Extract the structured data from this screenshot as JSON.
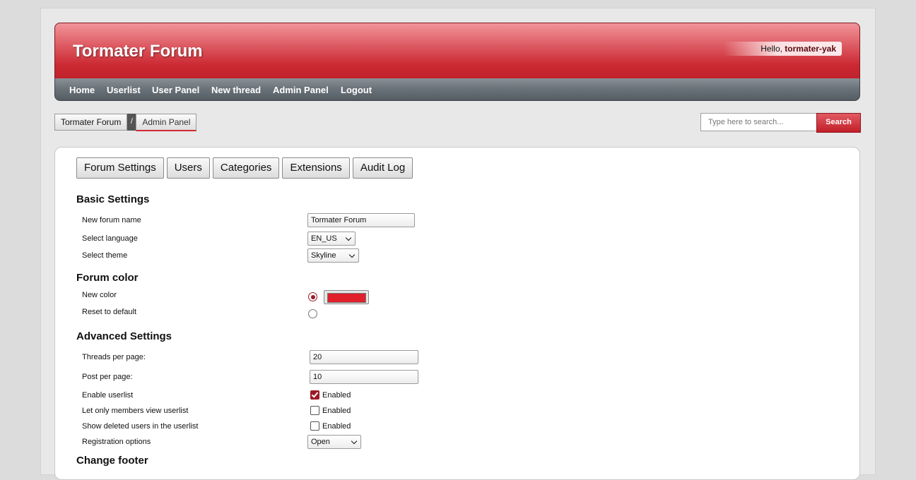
{
  "header": {
    "forum_title": "Tormater Forum",
    "hello_prefix": "Hello,",
    "username": "tormater-yak"
  },
  "nav": {
    "items": [
      "Home",
      "Userlist",
      "User Panel",
      "New thread",
      "Admin Panel",
      "Logout"
    ]
  },
  "breadcrumb": {
    "root": "Tormater Forum",
    "separator": "/",
    "current": "Admin Panel"
  },
  "search": {
    "placeholder": "Type here to search...",
    "button_label": "Search"
  },
  "tabs": [
    "Forum Settings",
    "Users",
    "Categories",
    "Extensions",
    "Audit Log"
  ],
  "basic_settings": {
    "title": "Basic Settings",
    "forum_name_label": "New forum name",
    "forum_name_value": "Tormater Forum",
    "language_label": "Select language",
    "language_value": "EN_US",
    "theme_label": "Select theme",
    "theme_value": "Skyline"
  },
  "forum_color": {
    "title": "Forum color",
    "new_color_label": "New color",
    "reset_label": "Reset to default",
    "color_value": "#e0202a",
    "selected_option": "New color"
  },
  "advanced_settings": {
    "title": "Advanced Settings",
    "threads_label": "Threads per page:",
    "threads_value": "20",
    "posts_label": "Post per page:",
    "posts_value": "10",
    "enable_userlist_label": "Enable userlist",
    "enable_userlist_checked": true,
    "members_only_label": "Let only members view userlist",
    "members_only_checked": false,
    "show_deleted_label": "Show deleted users in the userlist",
    "show_deleted_checked": false,
    "checkbox_text": "Enabled",
    "registration_label": "Registration options",
    "registration_value": "Open"
  },
  "footer_section": {
    "title": "Change footer"
  },
  "colors": {
    "accent": "#c0212b",
    "nav_bg": "#5f676e"
  }
}
